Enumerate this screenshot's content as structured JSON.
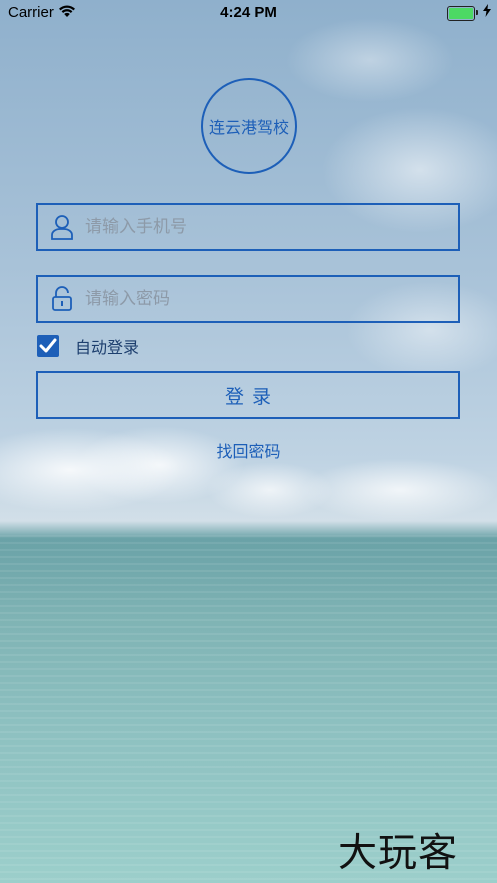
{
  "status_bar": {
    "carrier": "Carrier",
    "time": "4:24 PM",
    "battery_icon": "battery-full-icon",
    "charging_icon": "charging-bolt-icon",
    "wifi_icon": "wifi-icon"
  },
  "logo": {
    "text": "连云港驾校"
  },
  "login_form": {
    "phone_placeholder": "请输入手机号",
    "phone_icon": "user-icon",
    "password_placeholder": "请输入密码",
    "password_icon": "lock-icon",
    "auto_login_label": "自动登录",
    "auto_login_checked": true,
    "login_button_label": "登录",
    "forgot_password_link": "找回密码"
  },
  "watermark": {
    "text": "大玩客"
  },
  "colors": {
    "accent": "#1d5fb8",
    "battery": "#4cd964"
  }
}
